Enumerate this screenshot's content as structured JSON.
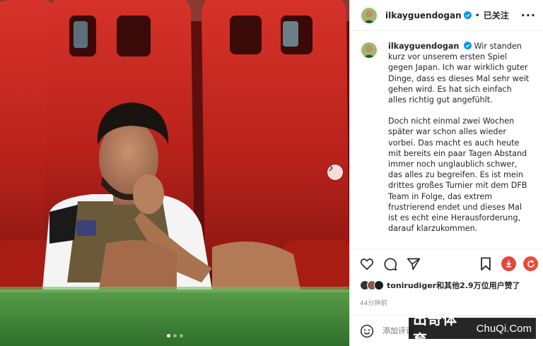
{
  "post": {
    "username": "ilkayguendogan",
    "separator": "•",
    "follow_status": "已关注",
    "caption_p1": "Wir standen kurz vor unserem ersten Spiel gegen Japan. Ich war wirklich guter Dinge, dass es dieses Mal sehr weit gehen wird. Es hat sich einfach alles richtig gut angefühlt.",
    "caption_p2": "Doch nicht einmal zwei Wochen später war schon alles wieder vorbei. Das macht es auch heute mit bereits ein paar Tagen Abstand immer noch unglaublich schwer, das alles zu begreifen. Es ist mein drittes großes Turnier mit dem DFB Team in Folge, das extrem frustrierend endet und dieses Mal ist es echt eine Herausforderung, darauf klarzukommen.",
    "likes_text": "tonirudiger和其他2.9万位用户赞了",
    "time_ago": "44分钟前",
    "comment_placeholder": "添加评论...",
    "carousel": {
      "count": 3,
      "active_index": 1
    }
  },
  "watermark": {
    "cn": "出奇体育",
    "en": "ChuQi.Com"
  },
  "colors": {
    "verified_blue": "#0095f6",
    "download_red": "#e2493a",
    "refresh_red": "#ea4b3c",
    "seat_red": "#c8261e",
    "grass_green": "#3f8a3a"
  },
  "icons": [
    "verified-icon",
    "more-icon",
    "heart-icon",
    "comment-icon",
    "share-icon",
    "bookmark-icon",
    "download-icon",
    "refresh-icon",
    "emoji-icon",
    "chevron-right-icon"
  ]
}
